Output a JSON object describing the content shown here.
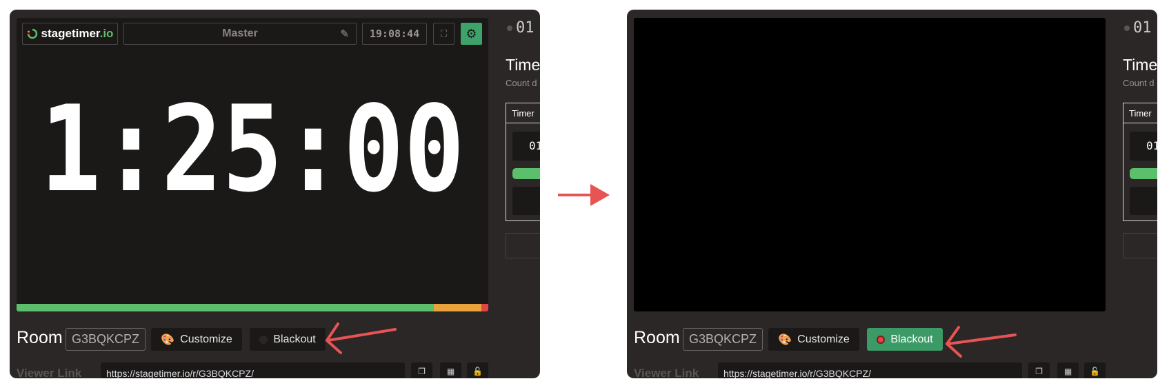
{
  "panels": [
    {
      "state": "before",
      "logo": {
        "name": "stagetimer",
        "tld": ".io"
      },
      "timer_name": "Master",
      "clock": "19:08:44",
      "big_time": "1:25:00",
      "blackout_active": false,
      "progress": {
        "green": 0.884,
        "orange": 0.102,
        "red": 0.014
      },
      "room_label": "Room",
      "room_code": "G3BQKCPZ",
      "customize_label": "Customize",
      "blackout_label": "Blackout",
      "viewer_link_label": "Viewer Link",
      "viewer_link_url": "https://stagetimer.io/r/G3BQKCPZ/",
      "sidebar": {
        "timer_index": "01",
        "title": "Time",
        "subtitle": "Count d",
        "table_header": "Timer",
        "card_value": "01"
      }
    },
    {
      "state": "after",
      "logo": null,
      "blackout_active": true,
      "room_label": "Room",
      "room_code": "G3BQKCPZ",
      "customize_label": "Customize",
      "blackout_label": "Blackout",
      "viewer_link_label": "Viewer Link",
      "viewer_link_url": "https://stagetimer.io/r/G3BQKCPZ/",
      "sidebar": {
        "timer_index": "01",
        "title": "Time",
        "subtitle": "Count d",
        "table_header": "Timer",
        "card_value": "01"
      }
    }
  ],
  "colors": {
    "accent": "#3c9a67",
    "bar_green": "#5bbf6b",
    "bar_orange": "#eaa23c",
    "bar_red": "#e04646",
    "annotation": "#e85454"
  }
}
